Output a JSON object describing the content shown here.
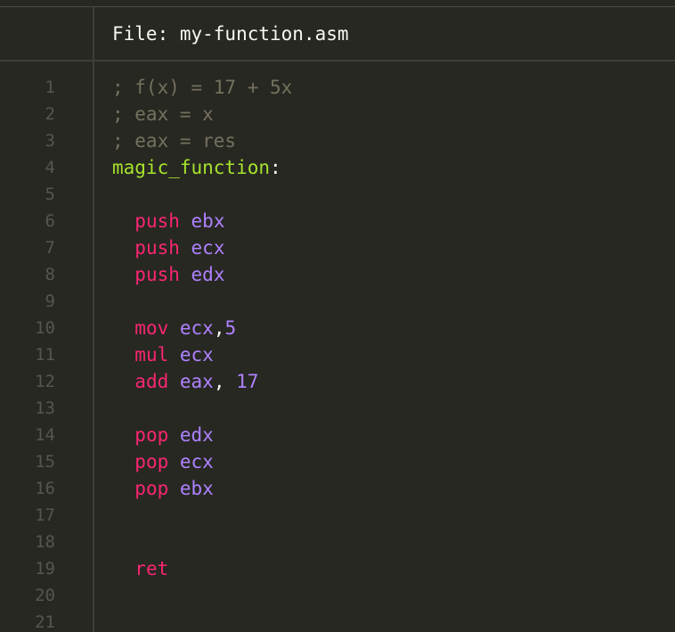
{
  "header": {
    "file_prefix": "File: ",
    "file_name": "my-function.asm"
  },
  "gutter": {
    "line_numbers": [
      "1",
      "2",
      "3",
      "4",
      "5",
      "6",
      "7",
      "8",
      "9",
      "10",
      "11",
      "12",
      "13",
      "14",
      "15",
      "16",
      "17",
      "18",
      "19",
      "20",
      "21"
    ]
  },
  "code": {
    "line1": {
      "comment": "; f(x) = 17 + 5x"
    },
    "line2": {
      "comment": "; eax = x"
    },
    "line3": {
      "comment": "; eax = res"
    },
    "line4": {
      "label": "magic_function",
      "colon": ":"
    },
    "line6": {
      "indent": "  ",
      "instr": "push",
      "sp": " ",
      "operand": "ebx"
    },
    "line7": {
      "indent": "  ",
      "instr": "push",
      "sp": " ",
      "operand": "ecx"
    },
    "line8": {
      "indent": "  ",
      "instr": "push",
      "sp": " ",
      "operand": "edx"
    },
    "line10": {
      "indent": "  ",
      "instr": "mov",
      "sp": " ",
      "operand": "ecx",
      "comma": ",",
      "value": "5"
    },
    "line11": {
      "indent": "  ",
      "instr": "mul",
      "sp": " ",
      "operand": "ecx"
    },
    "line12": {
      "indent": "  ",
      "instr": "add",
      "sp": " ",
      "operand": "eax",
      "comma": ", ",
      "value": "17"
    },
    "line14": {
      "indent": "  ",
      "instr": "pop",
      "sp": " ",
      "operand": "edx"
    },
    "line15": {
      "indent": "  ",
      "instr": "pop",
      "sp": " ",
      "operand": "ecx"
    },
    "line16": {
      "indent": "  ",
      "instr": "pop",
      "sp": " ",
      "operand": "ebx"
    },
    "line19": {
      "indent": "  ",
      "instr": "ret"
    }
  },
  "colors": {
    "background": "#272822",
    "text": "#f8f8f2",
    "comment": "#75715e",
    "label": "#a6e22e",
    "keyword": "#f92672",
    "register": "#ae81ff",
    "line_number": "#56564e"
  }
}
